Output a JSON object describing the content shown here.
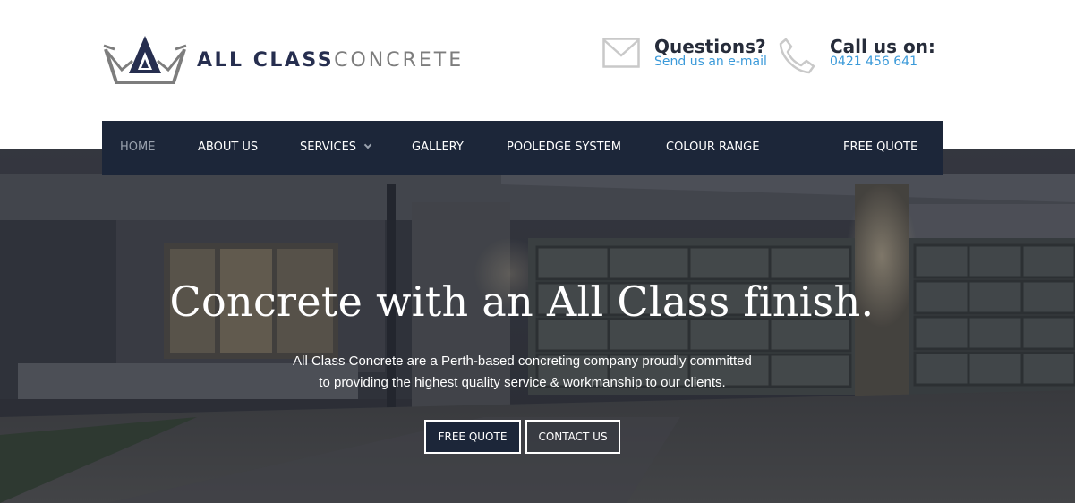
{
  "brand": {
    "name_part1": "ALL CLASS",
    "name_part2": "CONCRETE",
    "logo_icon": "crown-logo-icon",
    "color_primary": "#262e4f",
    "color_secondary": "#7d7d7d"
  },
  "contact": {
    "email": {
      "icon": "envelope-icon",
      "title": "Questions?",
      "link": "Send us an e-mail"
    },
    "phone": {
      "icon": "phone-icon",
      "title": "Call us on:",
      "number": "0421 456 641"
    },
    "accent_color": "#3b9ad9"
  },
  "nav": {
    "background": "#1c2639",
    "items": [
      {
        "label": "HOME",
        "active": true
      },
      {
        "label": "ABOUT US"
      },
      {
        "label": "SERVICES",
        "has_dropdown": true
      },
      {
        "label": "GALLERY"
      },
      {
        "label": "POOLEDGE SYSTEM"
      },
      {
        "label": "COLOUR RANGE"
      },
      {
        "label": "FREE QUOTE"
      }
    ]
  },
  "hero": {
    "title": "Concrete with an All Class finish.",
    "text_line1": "All Class Concrete are a Perth-based concreting company proudly committed",
    "text_line2": "to providing the highest quality service & workmanship to our clients.",
    "buttons": {
      "free_quote": "FREE QUOTE",
      "contact_us": "CONTACT US"
    }
  }
}
